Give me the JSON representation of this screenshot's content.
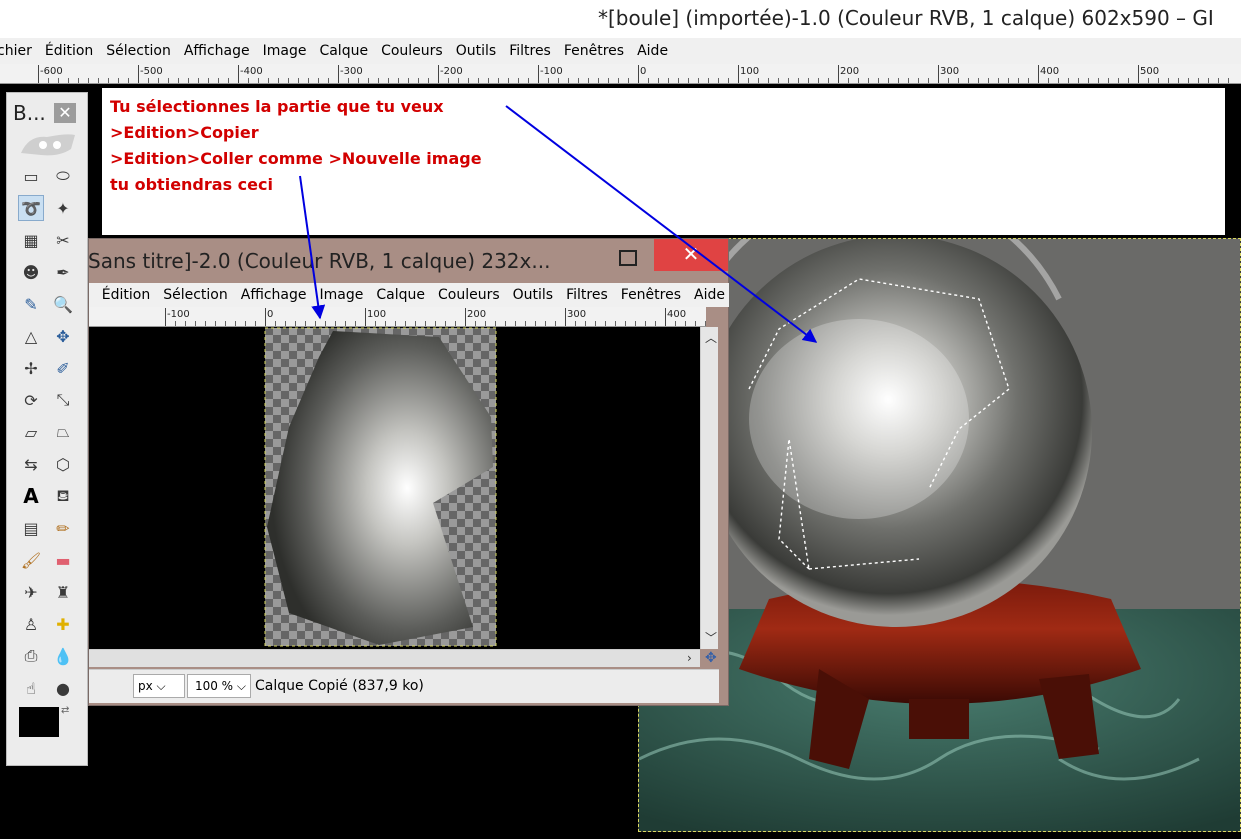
{
  "main_window": {
    "title": "*[boule] (importée)-1.0 (Couleur RVB, 1 calque) 602x590 – GI",
    "menu": [
      "chier",
      "Édition",
      "Sélection",
      "Affichage",
      "Image",
      "Calque",
      "Couleurs",
      "Outils",
      "Filtres",
      "Fenêtres",
      "Aide"
    ],
    "ruler_labels": [
      "-600",
      "-500",
      "-400",
      "-300",
      "-200",
      "-100",
      "0",
      "100",
      "200",
      "300",
      "400",
      "500"
    ]
  },
  "annotation": {
    "lines": [
      "Tu sélectionnes la partie que tu veux",
      ">Edition>Copier",
      ">Edition>Coller comme >Nouvelle image",
      "tu obtiendras ceci"
    ],
    "text_color": "#d20000",
    "arrow_color": "#0000e0"
  },
  "toolbox": {
    "title": "B...",
    "close": "✕",
    "tools": [
      "rect-select-icon",
      "ellipse-select-icon",
      "free-select-icon",
      "fuzzy-select-icon",
      "color-select-icon",
      "scissors-icon",
      "foreground-select-icon",
      "paths-icon",
      "color-picker-icon",
      "zoom-icon",
      "measure-icon",
      "move-icon",
      "align-icon",
      "crop-icon",
      "rotate-icon",
      "scale-icon",
      "shear-icon",
      "perspective-icon",
      "flip-icon",
      "cage-icon",
      "text-icon",
      "bucket-fill-icon",
      "blend-icon",
      "pencil-icon",
      "paintbrush-icon",
      "eraser-icon",
      "airbrush-icon",
      "ink-icon",
      "clone-icon",
      "heal-icon",
      "perspective-clone-icon",
      "blur-icon",
      "smudge-icon",
      "dodge-burn-icon"
    ],
    "fg_color": "#000000",
    "bg_color": "#ffffff"
  },
  "sub_window": {
    "title": "Sans titre]-2.0 (Couleur RVB, 1 calque) 232x...",
    "close": "✕",
    "menu": [
      "r",
      "Édition",
      "Sélection",
      "Affichage",
      "Image",
      "Calque",
      "Couleurs",
      "Outils",
      "Filtres",
      "Fenêtres",
      "Aide"
    ],
    "ruler_labels": [
      "-100",
      "0",
      "100",
      "200",
      "300",
      "400"
    ],
    "unit": "px",
    "zoom": "100 %",
    "status": "Calque Copié (837,9 ko)"
  }
}
